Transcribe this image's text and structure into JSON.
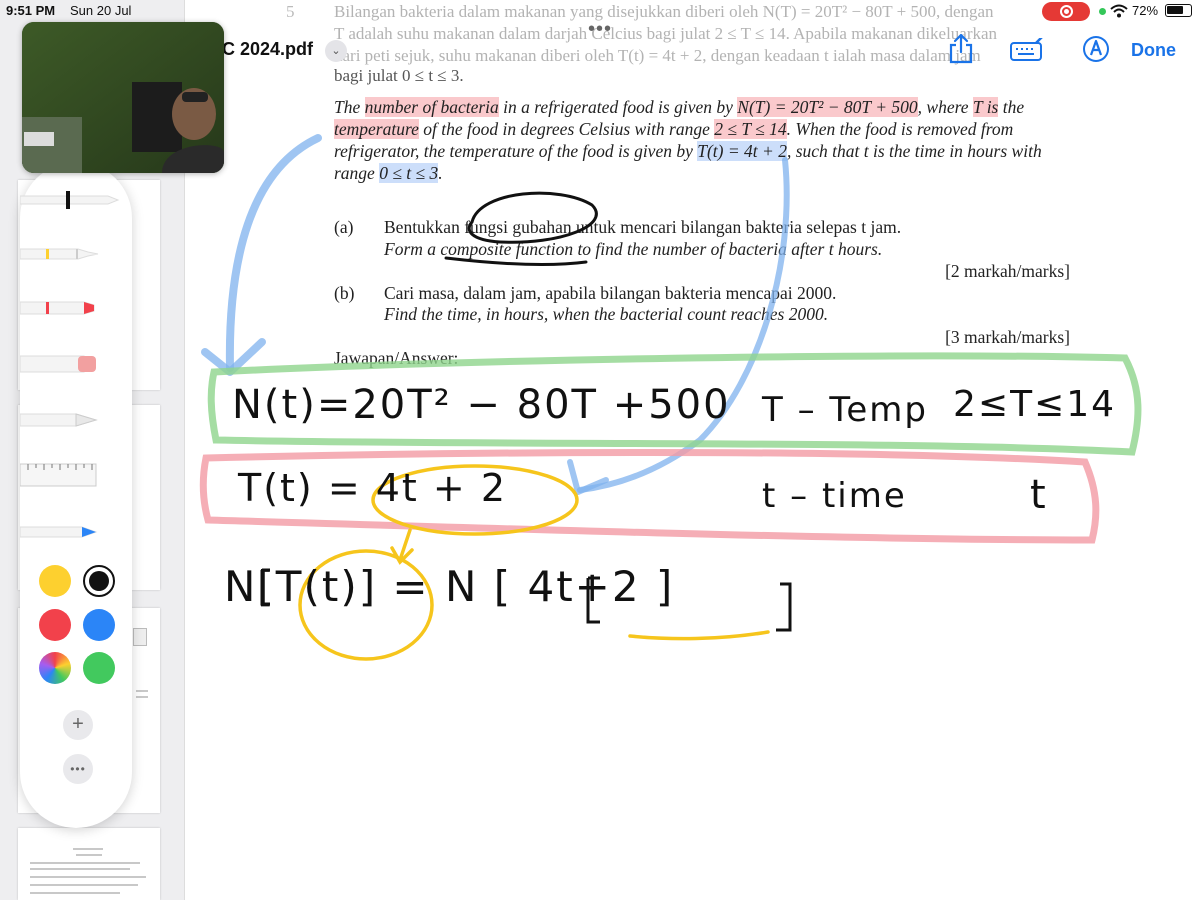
{
  "status_bar": {
    "time": "9:51 PM",
    "date": "Sun 20 Jul",
    "battery": "72%",
    "battery_level": 0.72
  },
  "navbar": {
    "title": "C 2024.pdf",
    "done": "Done",
    "share_icon": "share-icon",
    "keyboard_icon": "keyboard-icon",
    "markup_icon": "markup-pen-icon"
  },
  "toolbar": {
    "tools": [
      "pen",
      "monoline",
      "marker",
      "eraser",
      "pencil",
      "ruler",
      "fountain-pen"
    ],
    "colors": [
      "#fdd02f",
      "#111111",
      "#f2414b",
      "#2b85f7",
      "multicolor",
      "#42c95e"
    ],
    "selected_color": "#111111",
    "add": "+",
    "more": "•••"
  },
  "document": {
    "question_number": "5",
    "malay_faded_1": "Bilangan bakteria dalam makanan yang disejukkan diberi oleh N(T) = 20T² − 80T + 500, dengan",
    "malay_faded_2": "T adalah suhu makanan dalam darjah Celcius bagi julat 2 ≤ T ≤ 14. Apabila makanan dikeluarkan",
    "malay_faded_3": "dari peti sejuk, suhu makanan diberi oleh T(t) = 4t + 2, dengan keadaan t ialah masa dalam jam",
    "malay_faded_4": "bagi julat 0 ≤ t ≤ 3.",
    "para_1": "The ",
    "para_hl_1": "number of bacteria",
    "para_2": " in a refrigerated food is given by ",
    "para_hl_2": " N(T) = 20T² − 80T + 500",
    "para_3": ", where ",
    "para_hl_3": "T is",
    "para_4": "the ",
    "para_hl_4": "temperature",
    "para_5": " of the food in degrees Celsius with range ",
    "para_hl_5": " 2 ≤ T ≤ 14",
    "para_6": ". When the food is removed from refrigerator, the temperature of the food is given by ",
    "para_hl_6": "T(t) = 4t + 2",
    "para_7": ", such that t is the time in hours with range ",
    "para_hl_7": "0 ≤ t ≤ 3",
    "para_8": ".",
    "part_a_label": "(a)",
    "part_a_malay": "Bentukkan fungsi gubahan untuk mencari bilangan bakteria selepas t jam.",
    "part_a_eng": "Form a composite function to find the number of bacteria after t hours.",
    "part_a_marks": "[2 markah/marks]",
    "part_b_label": "(b)",
    "part_b_malay": "Cari masa, dalam jam, apabila bilangan bakteria mencapai 2000.",
    "part_b_eng": "Find the time, in hours, when the bacterial count reaches 2000.",
    "part_b_marks": "[3 markah/marks]",
    "answer_label": "Jawapan/Answer:"
  },
  "handwriting": {
    "line1_eq": "N(t)=20T² − 80T +500",
    "line1_note": "T – Temp",
    "line1_range": "2≤T≤14",
    "line2_eq": "T(t) = 4t + 2",
    "line2_note": "t – time",
    "line2_var": "t",
    "line3_eq": "N[T(t)] = N [ 4t+2 ]"
  }
}
